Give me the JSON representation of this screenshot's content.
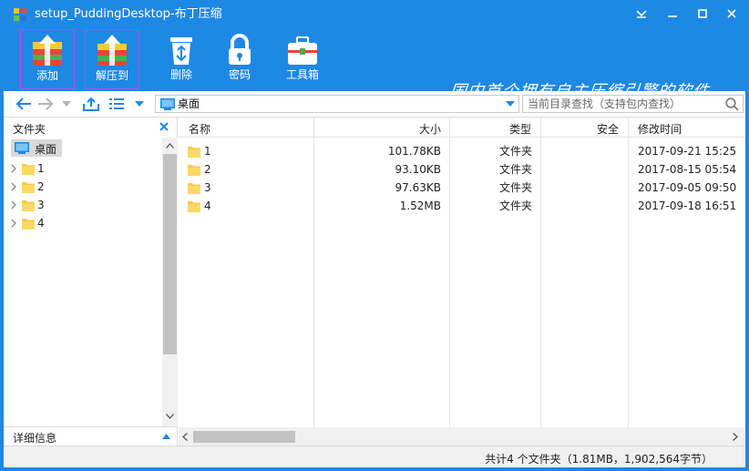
{
  "window": {
    "title": "setup_PuddingDesktop-布丁压缩",
    "accent": "#1e88e5"
  },
  "toolbar": {
    "items": [
      {
        "label": "添加",
        "icon": "add-archive-icon"
      },
      {
        "label": "解压到",
        "icon": "extract-to-icon"
      },
      {
        "label": "删除",
        "icon": "recycle-bin-icon"
      },
      {
        "label": "密码",
        "icon": "lock-icon"
      },
      {
        "label": "工具箱",
        "icon": "toolbox-icon"
      }
    ],
    "slogan": "国内首个拥有自主压缩引擎的软件"
  },
  "nav": {
    "address": "桌面",
    "search_placeholder": "当前目录查找（支持包内查找）"
  },
  "tree": {
    "header": "文件夹",
    "root": "桌面",
    "items": [
      "1",
      "2",
      "3",
      "4"
    ],
    "details_label": "详细信息"
  },
  "list": {
    "columns": {
      "name": "名称",
      "size": "大小",
      "type": "类型",
      "security": "安全",
      "modified": "修改时间"
    },
    "rows": [
      {
        "name": "1",
        "size": "101.78KB",
        "type": "文件夹",
        "modified": "2017-09-21 15:25"
      },
      {
        "name": "2",
        "size": "93.10KB",
        "type": "文件夹",
        "modified": "2017-08-15 05:54"
      },
      {
        "name": "3",
        "size": "97.63KB",
        "type": "文件夹",
        "modified": "2017-09-05 09:50"
      },
      {
        "name": "4",
        "size": "1.52MB",
        "type": "文件夹",
        "modified": "2017-09-18 16:51"
      }
    ]
  },
  "status": {
    "text": "共计4 个文件夹（1.81MB，1,902,564字节）"
  }
}
